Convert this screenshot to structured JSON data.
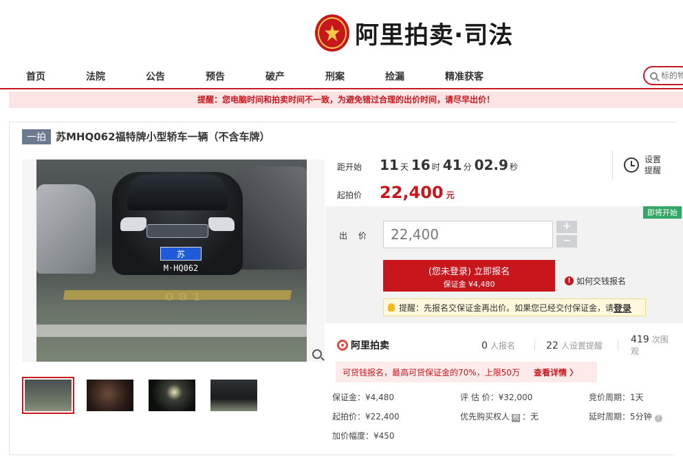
{
  "brand": {
    "logo_text": "阿里拍卖·司法",
    "sub_brand": "阿里拍卖"
  },
  "nav": {
    "items": [
      "首页",
      "法院",
      "公告",
      "预告",
      "破产",
      "刑案",
      "捡漏",
      "精准获客"
    ],
    "search_placeholder": "标的物"
  },
  "notice": "提醒：您电脑时间和拍卖时间不一致，为避免错过合理的出价时间，请尽早出价！",
  "item": {
    "tag": "一拍",
    "title": "苏MHQ062福特牌小型轿车一辆（不含车牌）",
    "plate_text": "苏M·HQ062",
    "floor_number": "081"
  },
  "countdown": {
    "label": "距开始",
    "days": "11",
    "day_unit": "天",
    "hours": "16",
    "hour_unit": "时",
    "minutes": "41",
    "minute_unit": "分",
    "seconds": "02.9",
    "second_unit": "秒"
  },
  "reminder": {
    "label": "设置提醒"
  },
  "starting_price": {
    "label": "起拍价",
    "value": "22,400",
    "unit": "元"
  },
  "bid": {
    "status_badge": "即将开始",
    "label": "出 价",
    "value": "22,400",
    "plus": "+",
    "minus": "−",
    "signup_main": "(您未登录) 立即报名",
    "signup_sub": "保证金 ¥4,480",
    "help_link": "如何交钱报名",
    "tip_text": "提醒：先报名交保证金再出价。如果您已经交付保证金，请",
    "tip_link": "登录"
  },
  "stats": {
    "registered_count": "0",
    "registered_label": "人报名",
    "reminders_count": "22",
    "reminders_label": "人设置提醒",
    "views_count": "419",
    "views_label": "次围观"
  },
  "loan": {
    "text": "可贷钱报名，最高可贷保证金的70%，上限50万",
    "link": "查看详情 〉"
  },
  "details": {
    "deposit": "保证金：¥4,480",
    "starting": "起拍价：¥22,400",
    "increment": "加价幅度：¥450",
    "appraisal": "评 估 价：¥32,000",
    "priority_label": "优先购买权人",
    "priority_badge": "税",
    "priority_value": "：无",
    "cycle": "竞价周期：1天",
    "extension": "延时周期：5分钟"
  },
  "colors": {
    "accent": "#c8161d",
    "badge_green": "#31a865",
    "tag_gray": "#6b7a8f"
  }
}
